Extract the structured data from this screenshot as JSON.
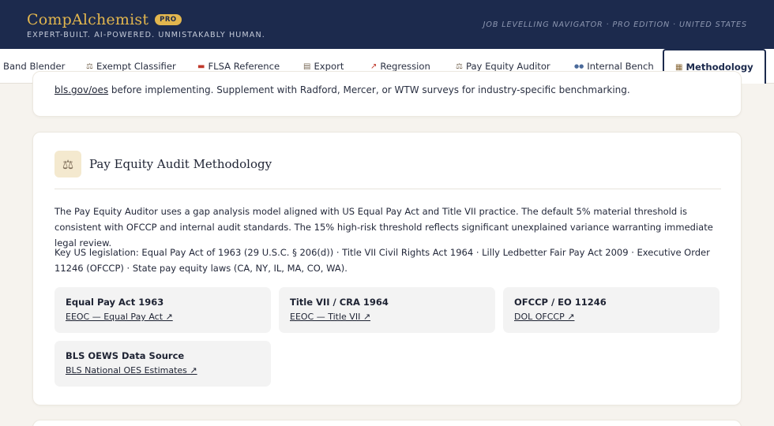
{
  "header": {
    "brand": "CompAlchemist",
    "badge": "PRO",
    "tagline": "EXPERT-BUILT. AI-POWERED. UNMISTAKABLY HUMAN.",
    "edition": "JOB LEVELLING NAVIGATOR · PRO EDITION · UNITED STATES"
  },
  "nav": {
    "tabs": [
      {
        "label": "Band Blender",
        "icon": ""
      },
      {
        "label": "Exempt Classifier",
        "icon": "⚖"
      },
      {
        "label": "FLSA Reference",
        "icon": "▬"
      },
      {
        "label": "Export",
        "icon": "▤"
      },
      {
        "label": "Regression",
        "icon": "↗"
      },
      {
        "label": "Pay Equity Auditor",
        "icon": "⚖"
      },
      {
        "label": "Internal Bench",
        "icon": "●●"
      },
      {
        "label": "Methodology",
        "icon": "▦"
      }
    ],
    "active_index": 7
  },
  "prev_card": {
    "link": "bls.gov/oes",
    "text": " before implementing. Supplement with Radford, Mercer, or WTW surveys for industry-specific benchmarking."
  },
  "section": {
    "icon": "scales-icon",
    "title": "Pay Equity Audit Methodology",
    "para1": "The Pay Equity Auditor uses a gap analysis model aligned with US Equal Pay Act and Title VII practice. The default 5% material threshold is consistent with OFCCP and internal audit standards. The 15% high-risk threshold reflects significant unexplained variance warranting immediate legal review.",
    "para2": "Key US legislation: Equal Pay Act of 1963 (29 U.S.C. § 206(d)) · Title VII Civil Rights Act 1964 · Lilly Ledbetter Fair Pay Act 2009 · Executive Order 11246 (OFCCP) · State pay equity laws (CA, NY, IL, MA, CO, WA).",
    "refs": [
      {
        "title": "Equal Pay Act 1963",
        "link": "EEOC — Equal Pay Act ↗"
      },
      {
        "title": "Title VII / CRA 1964",
        "link": "EEOC — Title VII ↗"
      },
      {
        "title": "OFCCP / EO 11246",
        "link": "DOL OFCCP ↗"
      },
      {
        "title": "BLS OEWS Data Source",
        "link": "BLS National OES Estimates ↗"
      }
    ]
  }
}
